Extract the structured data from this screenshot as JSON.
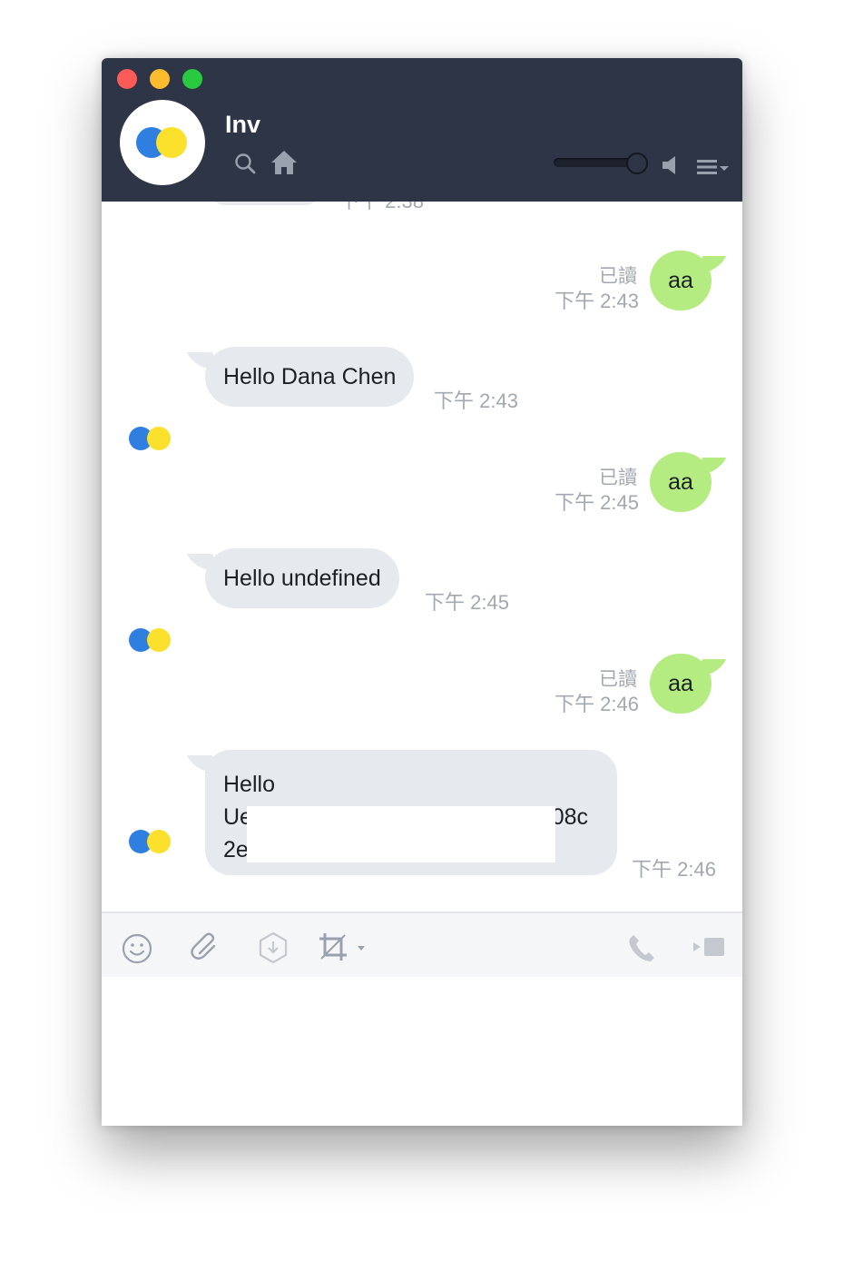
{
  "window": {
    "title": "Inv"
  },
  "colors": {
    "header_bg": "#2e3546",
    "my_bubble": "#b5ec82",
    "their_bubble": "#e6e9ed",
    "timestamp": "#a3a8b0"
  },
  "header": {
    "icons": [
      "search-icon",
      "home-icon",
      "volume-slider",
      "speaker-icon",
      "menu-icon"
    ],
    "volume": 0.85
  },
  "messages": [
    {
      "sender": "me",
      "text": "aa",
      "read": "已讀",
      "time": "下午 2:43"
    },
    {
      "sender": "them",
      "text": "Hello Dana Chen",
      "time": "下午 2:43"
    },
    {
      "sender": "me",
      "text": "aa",
      "read": "已讀",
      "time": "下午 2:45"
    },
    {
      "sender": "them",
      "text": "Hello undefined",
      "time": "下午 2:45"
    },
    {
      "sender": "me",
      "text": "aa",
      "read": "已讀",
      "time": "下午 2:46"
    },
    {
      "sender": "them",
      "lines": [
        "Hello",
        "Ue",
        "08c",
        "2e"
      ],
      "time": "下午 2:46"
    }
  ],
  "clipped_top": {
    "time": "下午 2:38"
  },
  "toolbar": {
    "icons": [
      "emoji-icon",
      "attach-icon",
      "keep-icon",
      "screenshot-icon",
      "call-icon",
      "video-call-icon"
    ]
  },
  "input": {
    "value": ""
  }
}
